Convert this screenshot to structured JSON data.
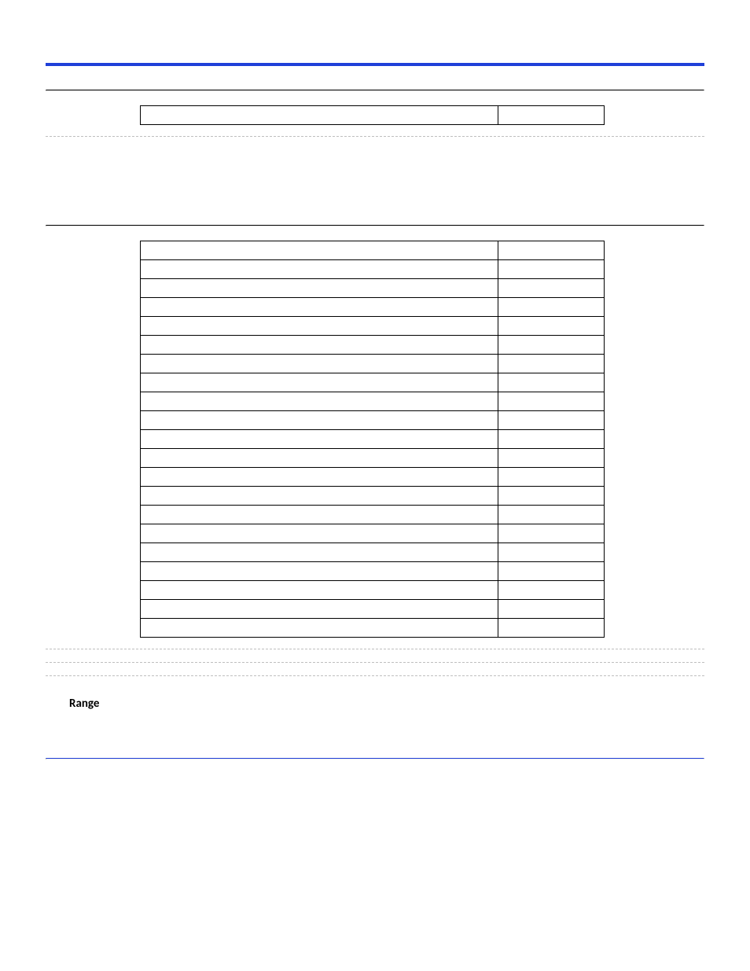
{
  "labels": {
    "range": "Range"
  },
  "tables": {
    "t1": {
      "rows": 1
    },
    "t2": {
      "rows": 21
    }
  }
}
